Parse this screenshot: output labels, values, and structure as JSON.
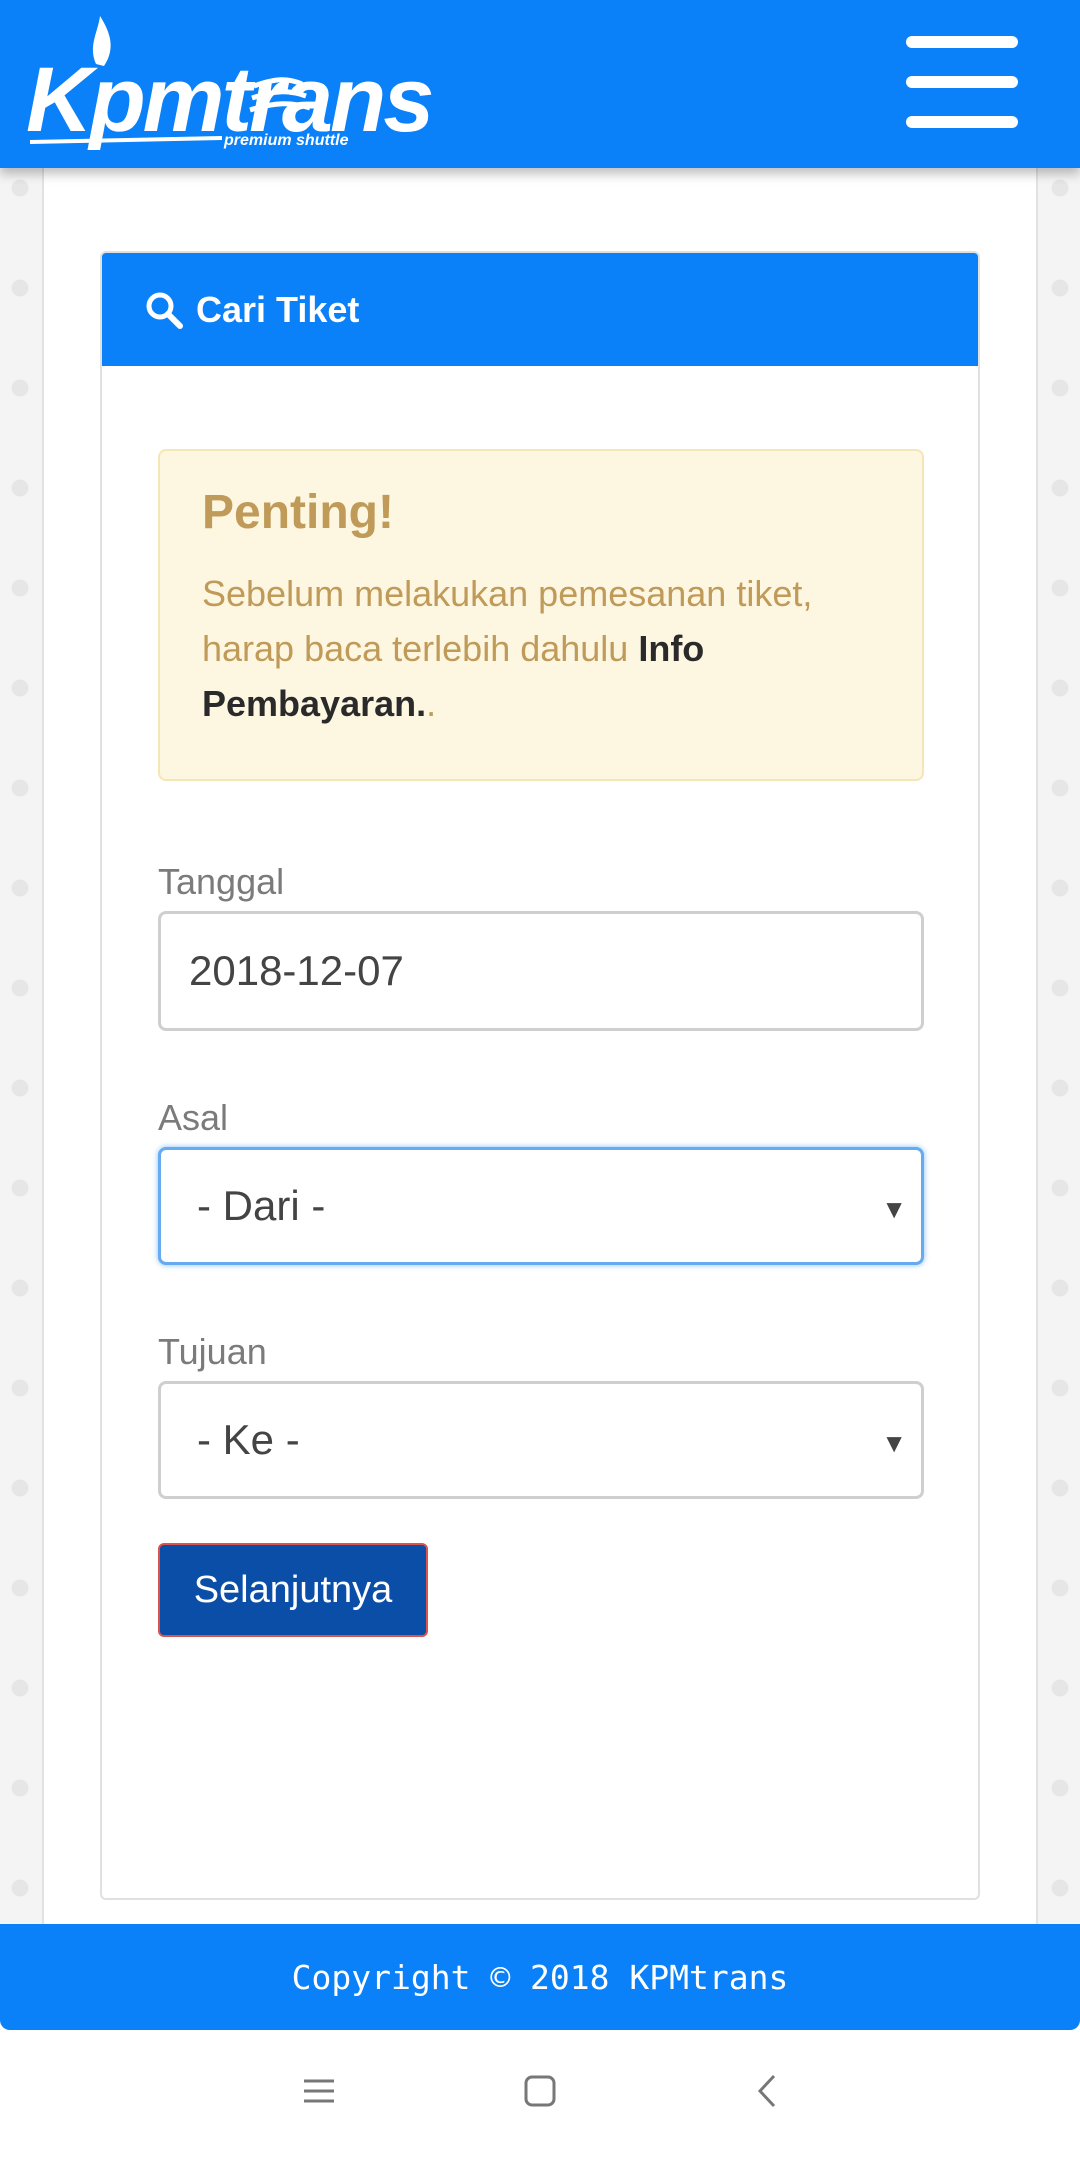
{
  "navbar": {
    "brand": "Kpmtrans",
    "tagline": "premium shuttle",
    "brand_color": "#0a80f9"
  },
  "card": {
    "title": "Cari Tiket",
    "icon": "search-icon"
  },
  "alert": {
    "title": "Penting!",
    "body_prefix": "Sebelum melakukan pemesanan tiket, harap baca terlebih dahulu ",
    "body_bold": "Info Pembayaran.",
    "body_suffix": "."
  },
  "form": {
    "tanggal_label": "Tanggal",
    "tanggal_value": "2018-12-07",
    "asal_label": "Asal",
    "asal_value": "- Dari -",
    "tujuan_label": "Tujuan",
    "tujuan_value": "- Ke -",
    "submit_label": "Selanjutnya"
  },
  "footer": {
    "text": "Copyright © 2018 KPMtrans"
  },
  "system_nav": {
    "icons": [
      "menu-icon",
      "home-icon",
      "back-icon"
    ]
  }
}
